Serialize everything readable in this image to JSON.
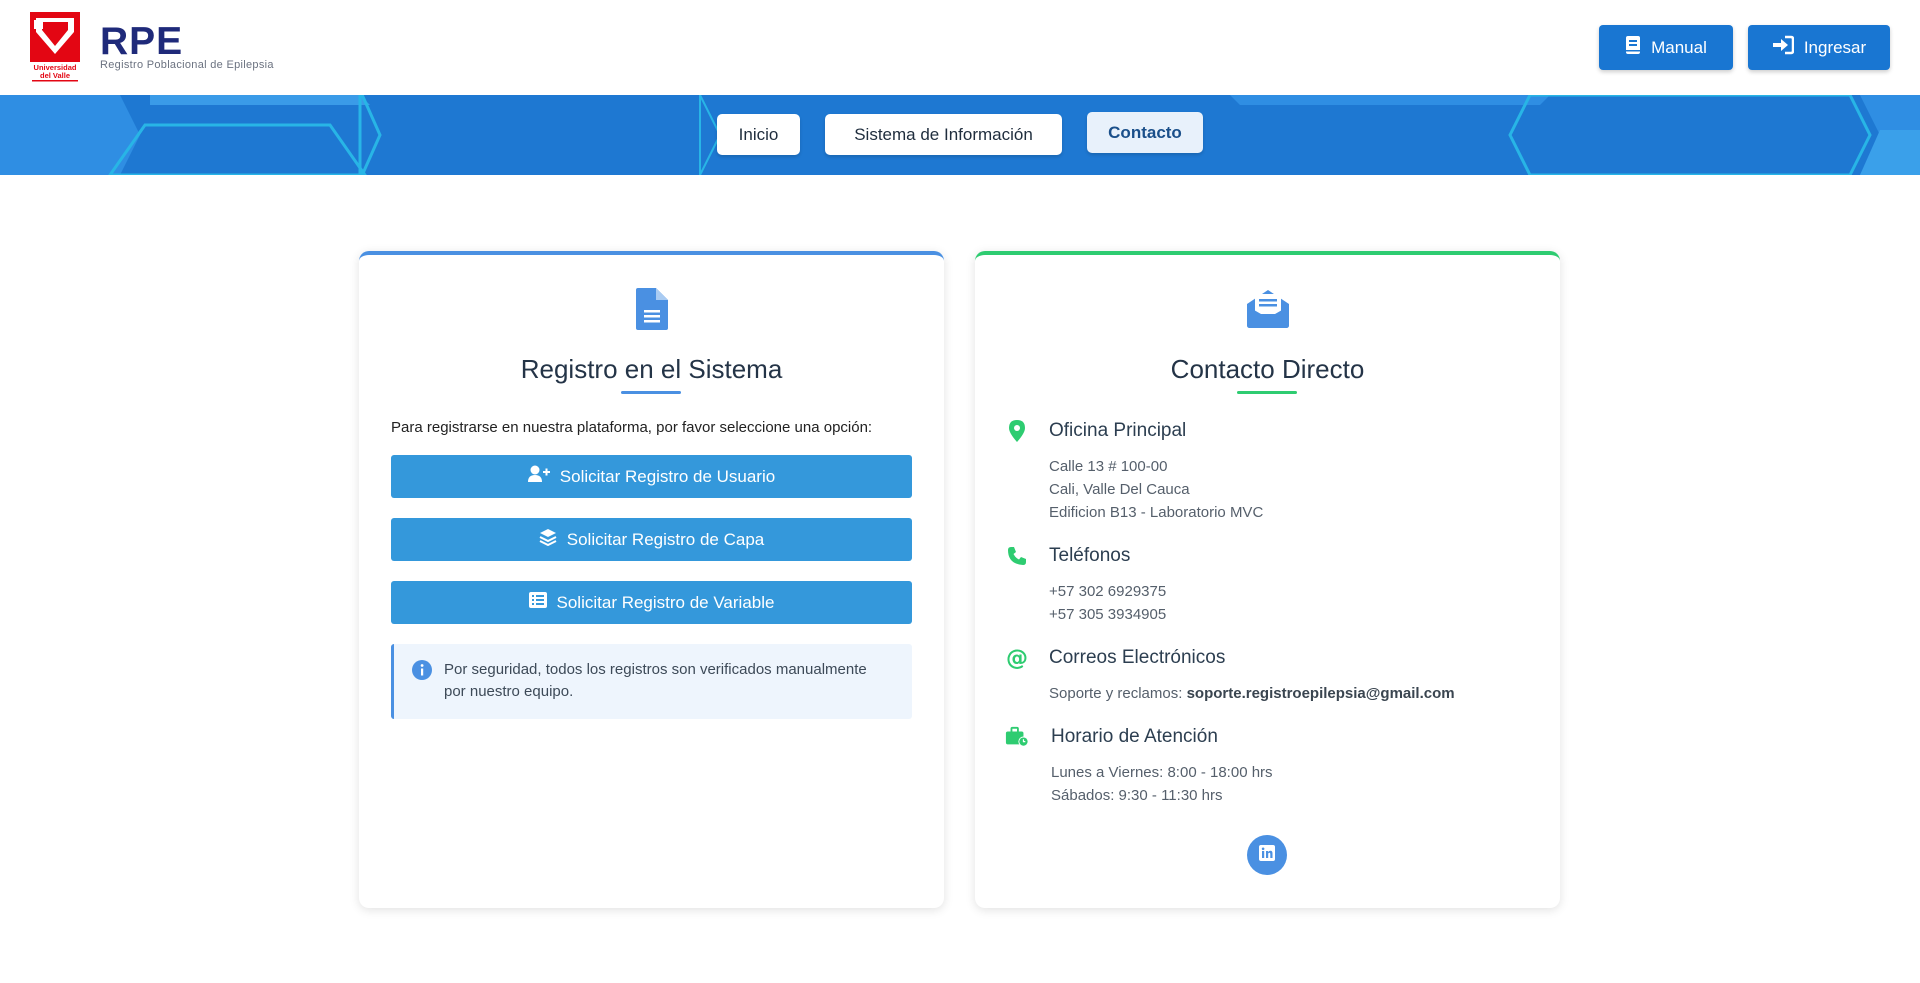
{
  "brand": {
    "logo_text": "Universidad del Valle",
    "title": "RPE",
    "subtitle": "Registro Poblacional de Epilepsia"
  },
  "header_buttons": {
    "manual": {
      "label": "Manual",
      "icon": "book-icon"
    },
    "ingresar": {
      "label": "Ingresar",
      "icon": "sign-in-icon"
    }
  },
  "nav": {
    "items": [
      {
        "label": "Inicio",
        "active": false
      },
      {
        "label": "Sistema de Información",
        "active": false
      },
      {
        "label": "Contacto",
        "active": true
      }
    ]
  },
  "registro": {
    "icon": "document-icon",
    "title": "Registro en el Sistema",
    "intro": "Para registrarse en nuestra plataforma, por favor seleccione una opción:",
    "buttons": [
      {
        "label": "Solicitar Registro de Usuario",
        "icon": "user-plus-icon"
      },
      {
        "label": "Solicitar Registro de Capa",
        "icon": "layers-icon"
      },
      {
        "label": "Solicitar Registro de Variable",
        "icon": "list-icon"
      }
    ],
    "info": "Por seguridad, todos los registros son verificados manualmente por nuestro equipo."
  },
  "contacto": {
    "icon": "envelope-open-icon",
    "title": "Contacto Directo",
    "oficina": {
      "title": "Oficina Principal",
      "lines": [
        "Calle 13 # 100-00",
        "Cali, Valle Del Cauca",
        "Edificion B13 - Laboratorio MVC"
      ]
    },
    "telefonos": {
      "title": "Teléfonos",
      "lines": [
        "+57 302 6929375",
        "+57 305 3934905"
      ]
    },
    "correos": {
      "title": "Correos Electrónicos",
      "label": "Soporte y reclamos:",
      "email": "soporte.registroepilepsia@gmail.com"
    },
    "horario": {
      "title": "Horario de Atención",
      "lines": [
        "Lunes a Viernes: 8:00 - 18:00 hrs",
        "Sábados: 9:30 - 11:30 hrs"
      ]
    },
    "social": {
      "icon": "linkedin-icon"
    }
  },
  "colors": {
    "primary": "#1976d2",
    "nav_bg": "#1e78d2",
    "button": "#3498db",
    "accent_blue": "#4a90e2",
    "accent_green": "#2ecc71",
    "brand_red": "#e30613",
    "brand_navy": "#1f2a7a"
  }
}
